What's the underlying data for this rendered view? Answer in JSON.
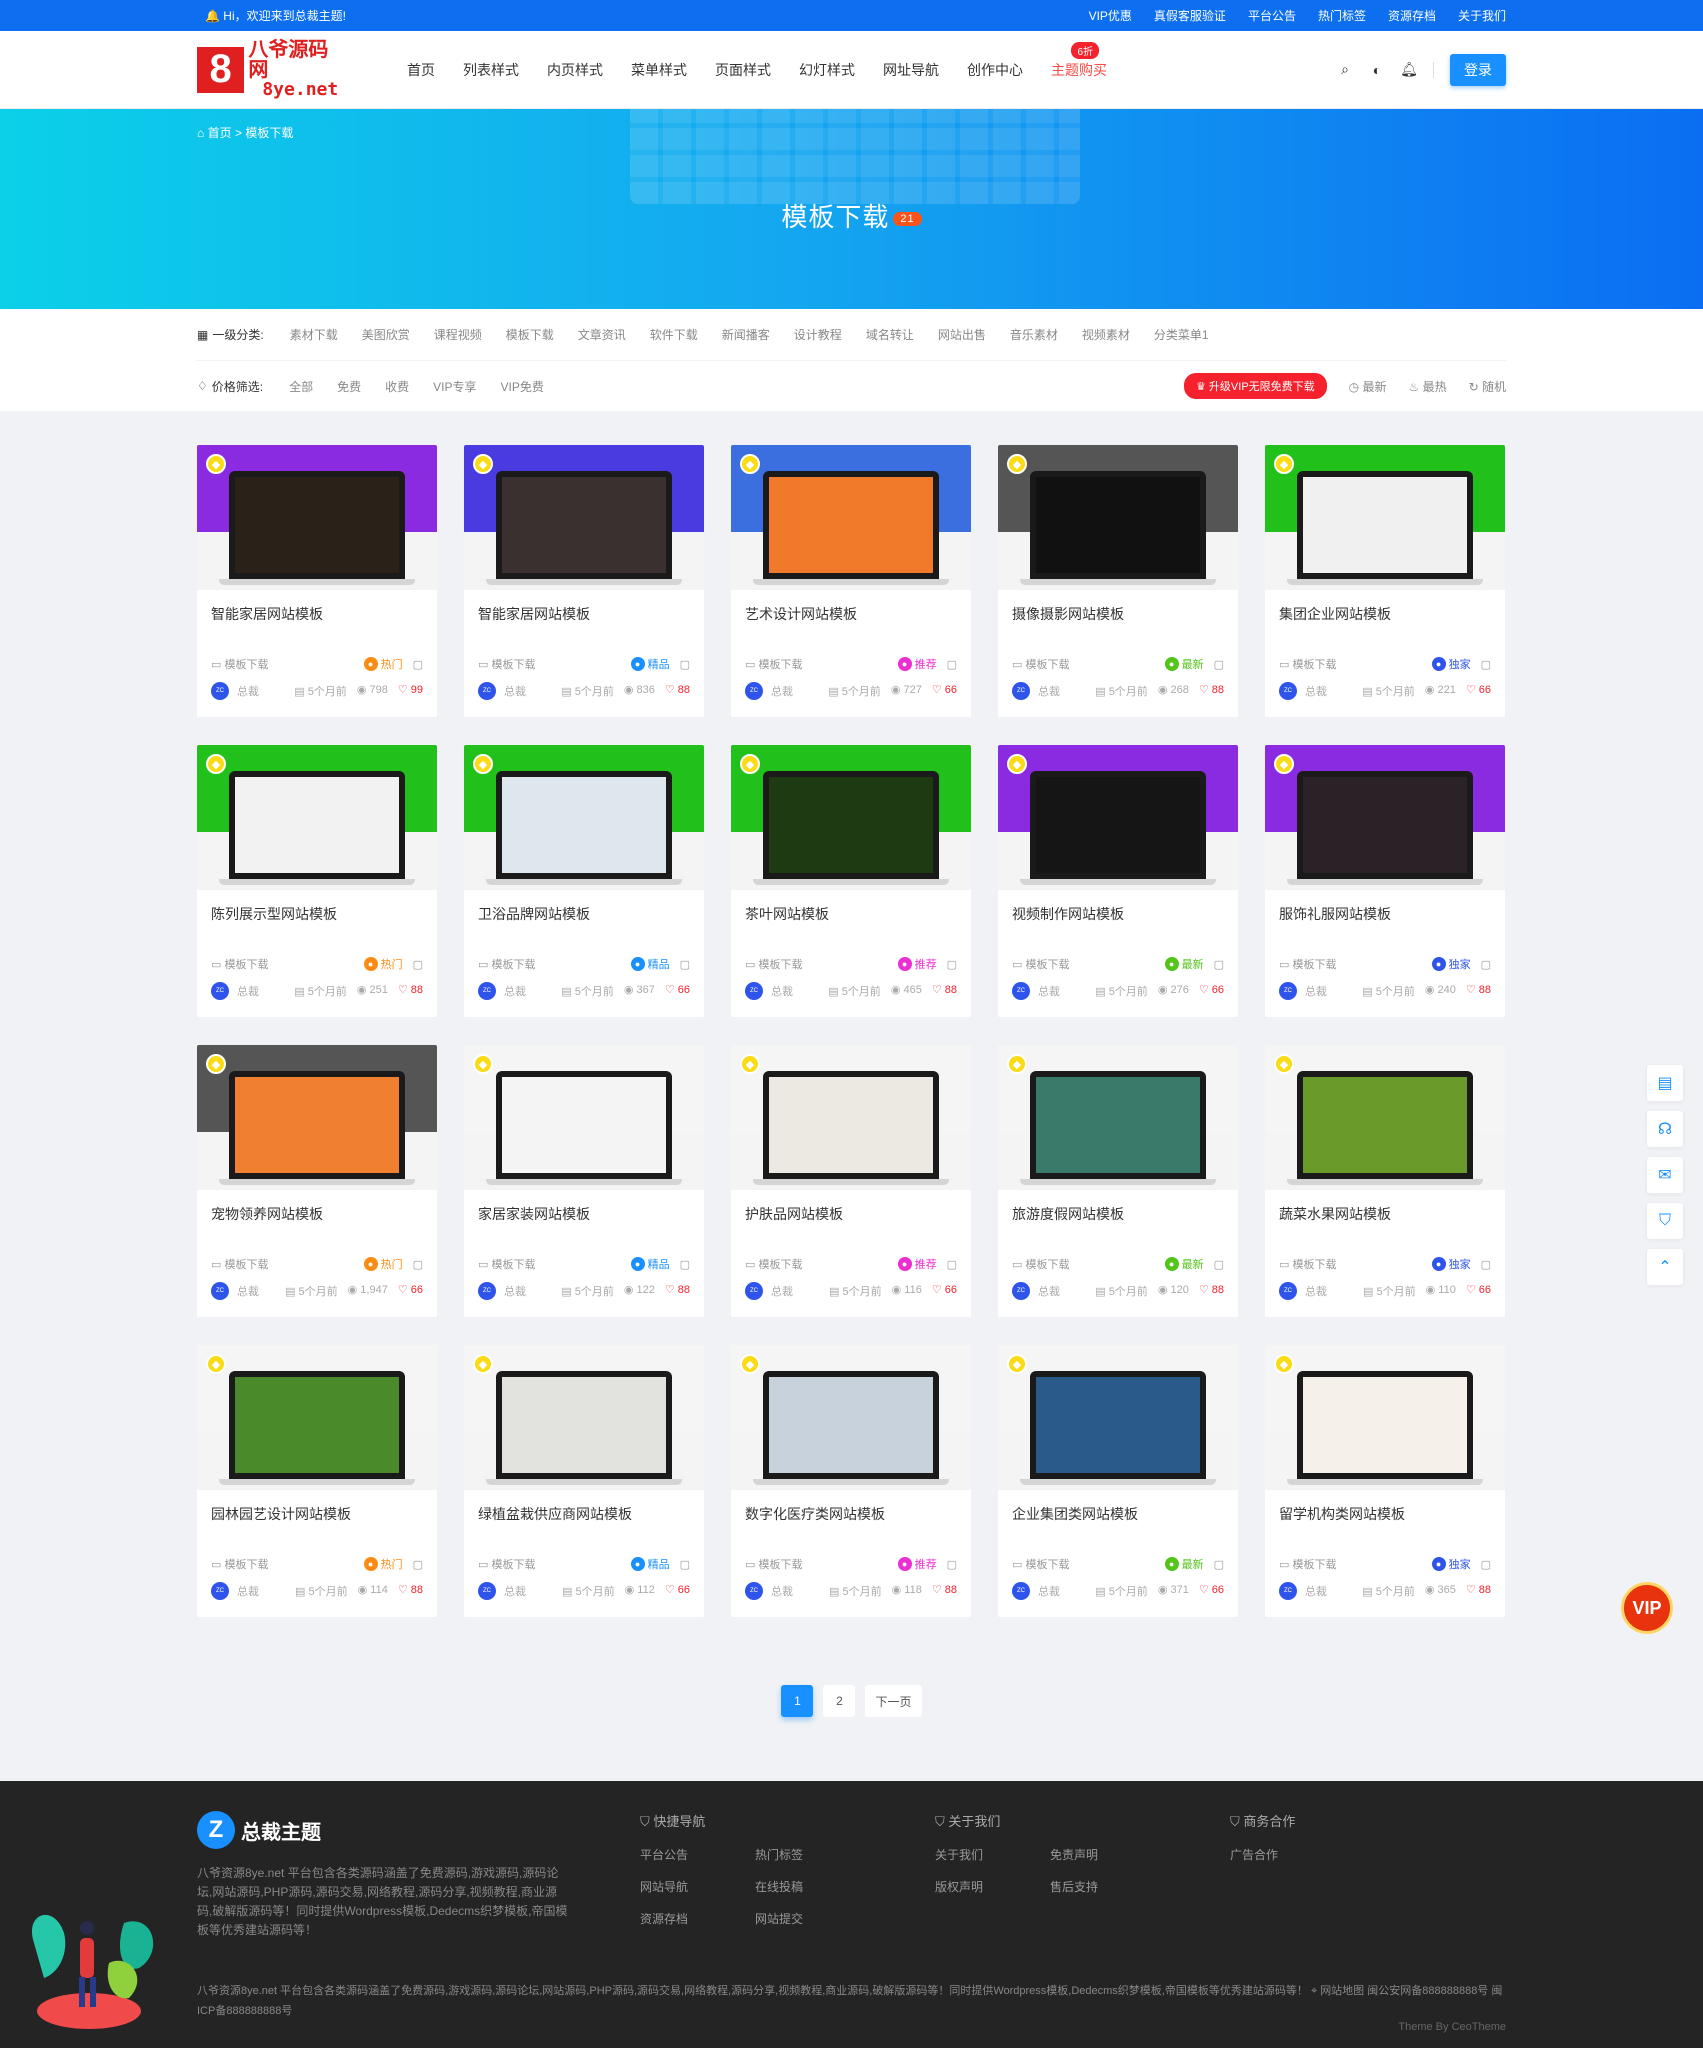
{
  "topbar": {
    "welcome": "Hi，欢迎来到总裁主题!",
    "links": [
      "VIP优惠",
      "真假客服验证",
      "平台公告",
      "热门标签",
      "资源存档",
      "关于我们"
    ]
  },
  "header": {
    "logo_cn": "八爷源码网",
    "logo_en": "8ye.net",
    "logo_digit": "8",
    "nav": [
      "首页",
      "列表样式",
      "内页样式",
      "菜单样式",
      "页面样式",
      "幻灯样式",
      "网址导航",
      "创作中心",
      "主题购买"
    ],
    "nav_badge": "6折",
    "login": "登录"
  },
  "banner": {
    "crumb_home": "首页",
    "crumb_sep": ">",
    "crumb_current": "模板下载",
    "title": "模板下载",
    "count": "21"
  },
  "filter": {
    "cat_label": "一级分类:",
    "categories": [
      "素材下载",
      "美图欣赏",
      "课程视频",
      "模板下载",
      "文章资讯",
      "软件下载",
      "新闻播客",
      "设计教程",
      "域名转让",
      "网站出售",
      "音乐素材",
      "视频素材",
      "分类菜单1"
    ],
    "price_label": "价格筛选:",
    "prices": [
      "全部",
      "免费",
      "收费",
      "VIP专享",
      "VIP免费"
    ],
    "vip_button": "升级VIP无限免费下载",
    "sorts": [
      "最新",
      "最热",
      "随机"
    ]
  },
  "cards": [
    {
      "title": "智能家居网站模板",
      "cat": "模板下载",
      "tag": "热门",
      "tag_color": "#fa8c16",
      "author": "总裁",
      "time": "5个月前",
      "views": "798",
      "likes": "99",
      "bg": "#8a2be2",
      "screen": "#2a2218"
    },
    {
      "title": "智能家居网站模板",
      "cat": "模板下载",
      "tag": "精品",
      "tag_color": "#1890ff",
      "author": "总裁",
      "time": "5个月前",
      "views": "836",
      "likes": "88",
      "bg": "#4a3be0",
      "screen": "#3a3030"
    },
    {
      "title": "艺术设计网站模板",
      "cat": "模板下载",
      "tag": "推荐",
      "tag_color": "#eb2fd0",
      "author": "总裁",
      "time": "5个月前",
      "views": "727",
      "likes": "66",
      "bg": "#3b6fe0",
      "screen": "#f07a2a"
    },
    {
      "title": "摄像摄影网站模板",
      "cat": "模板下载",
      "tag": "最新",
      "tag_color": "#52c41a",
      "author": "总裁",
      "time": "5个月前",
      "views": "268",
      "likes": "88",
      "bg": "#555555",
      "screen": "#111111"
    },
    {
      "title": "集团企业网站模板",
      "cat": "模板下载",
      "tag": "独家",
      "tag_color": "#2f54eb",
      "author": "总裁",
      "time": "5个月前",
      "views": "221",
      "likes": "66",
      "bg": "#22c01a",
      "screen": "#f0f0f0"
    },
    {
      "title": "陈列展示型网站模板",
      "cat": "模板下载",
      "tag": "热门",
      "tag_color": "#fa8c16",
      "author": "总裁",
      "time": "5个月前",
      "views": "251",
      "likes": "88",
      "bg": "#22c01a",
      "screen": "#f2f2f2"
    },
    {
      "title": "卫浴品牌网站模板",
      "cat": "模板下载",
      "tag": "精品",
      "tag_color": "#1890ff",
      "author": "总裁",
      "time": "5个月前",
      "views": "367",
      "likes": "66",
      "bg": "#22c01a",
      "screen": "#dfe7ee"
    },
    {
      "title": "茶叶网站模板",
      "cat": "模板下载",
      "tag": "推荐",
      "tag_color": "#eb2fd0",
      "author": "总裁",
      "time": "5个月前",
      "views": "465",
      "likes": "88",
      "bg": "#22c01a",
      "screen": "#1d3a12"
    },
    {
      "title": "视频制作网站模板",
      "cat": "模板下载",
      "tag": "最新",
      "tag_color": "#52c41a",
      "author": "总裁",
      "time": "5个月前",
      "views": "276",
      "likes": "66",
      "bg": "#8a2be2",
      "screen": "#151515"
    },
    {
      "title": "服饰礼服网站模板",
      "cat": "模板下载",
      "tag": "独家",
      "tag_color": "#2f54eb",
      "author": "总裁",
      "time": "5个月前",
      "views": "240",
      "likes": "88",
      "bg": "#8a2be2",
      "screen": "#2a2226"
    },
    {
      "title": "宠物领养网站模板",
      "cat": "模板下载",
      "tag": "热门",
      "tag_color": "#fa8c16",
      "author": "总裁",
      "time": "5个月前",
      "views": "1,947",
      "likes": "66",
      "bg": "#555555",
      "screen": "#f08030"
    },
    {
      "title": "家居家装网站模板",
      "cat": "模板下载",
      "tag": "精品",
      "tag_color": "#1890ff",
      "author": "总裁",
      "time": "5个月前",
      "views": "122",
      "likes": "88",
      "bg": "#f5f5f5",
      "screen": "#f4f4f4"
    },
    {
      "title": "护肤品网站模板",
      "cat": "模板下载",
      "tag": "推荐",
      "tag_color": "#eb2fd0",
      "author": "总裁",
      "time": "5个月前",
      "views": "116",
      "likes": "66",
      "bg": "#f5f5f5",
      "screen": "#ece8e2"
    },
    {
      "title": "旅游度假网站模板",
      "cat": "模板下载",
      "tag": "最新",
      "tag_color": "#52c41a",
      "author": "总裁",
      "time": "5个月前",
      "views": "120",
      "likes": "88",
      "bg": "#f5f5f5",
      "screen": "#3a7a6a"
    },
    {
      "title": "蔬菜水果网站模板",
      "cat": "模板下载",
      "tag": "独家",
      "tag_color": "#2f54eb",
      "author": "总裁",
      "time": "5个月前",
      "views": "110",
      "likes": "66",
      "bg": "#f5f5f5",
      "screen": "#6a9a2a"
    },
    {
      "title": "园林园艺设计网站模板",
      "cat": "模板下载",
      "tag": "热门",
      "tag_color": "#fa8c16",
      "author": "总裁",
      "time": "5个月前",
      "views": "114",
      "likes": "88",
      "bg": "#f5f5f5",
      "screen": "#4a8a2a"
    },
    {
      "title": "绿植盆栽供应商网站模板",
      "cat": "模板下载",
      "tag": "精品",
      "tag_color": "#1890ff",
      "author": "总裁",
      "time": "5个月前",
      "views": "112",
      "likes": "66",
      "bg": "#f5f5f5",
      "screen": "#e2e2de"
    },
    {
      "title": "数字化医疗类网站模板",
      "cat": "模板下载",
      "tag": "推荐",
      "tag_color": "#eb2fd0",
      "author": "总裁",
      "time": "5个月前",
      "views": "118",
      "likes": "88",
      "bg": "#f5f5f5",
      "screen": "#c8d2dc"
    },
    {
      "title": "企业集团类网站模板",
      "cat": "模板下载",
      "tag": "最新",
      "tag_color": "#52c41a",
      "author": "总裁",
      "time": "5个月前",
      "views": "371",
      "likes": "66",
      "bg": "#f5f5f5",
      "screen": "#2a5a8a"
    },
    {
      "title": "留学机构类网站模板",
      "cat": "模板下载",
      "tag": "独家",
      "tag_color": "#2f54eb",
      "author": "总裁",
      "time": "5个月前",
      "views": "365",
      "likes": "88",
      "bg": "#f5f5f5",
      "screen": "#f5f0ea"
    }
  ],
  "pager": {
    "pages": [
      "1",
      "2"
    ],
    "next": "下一页"
  },
  "sidebar": {
    "vip": "VIP"
  },
  "footer": {
    "brand": "总裁主题",
    "desc": "八爷资源8ye.net 平台包含各类源码涵盖了免费源码,游戏源码,源码论坛,网站源码,PHP源码,源码交易,网络教程,源码分享,视频教程,商业源码,破解版源码等！同时提供Wordpress模板,Dedecms织梦模板,帝国模板等优秀建站源码等！",
    "cols": [
      {
        "title": "快捷导航",
        "links": [
          "平台公告",
          "热门标签",
          "网站导航",
          "在线投稿",
          "资源存档",
          "网站提交"
        ]
      },
      {
        "title": "关于我们",
        "links": [
          "关于我们",
          "免责声明",
          "版权声明",
          "售后支持"
        ]
      },
      {
        "title": "商务合作",
        "links": [
          "广告合作"
        ]
      }
    ],
    "bottom": "八爷资源8ye.net 平台包含各类源码涵盖了免费源码,游戏源码,源码论坛,网站源码,PHP源码,源码交易,网络教程,源码分享,视频教程,商业源码,破解版源码等！同时提供Wordpress模板,Dedecms织梦模板,帝国模板等优秀建站源码等！",
    "sitemap": "网站地图",
    "beian": "闽公安网备888888888号",
    "icp": "闽ICP备888888888号",
    "theme": "Theme By CeoTheme"
  }
}
